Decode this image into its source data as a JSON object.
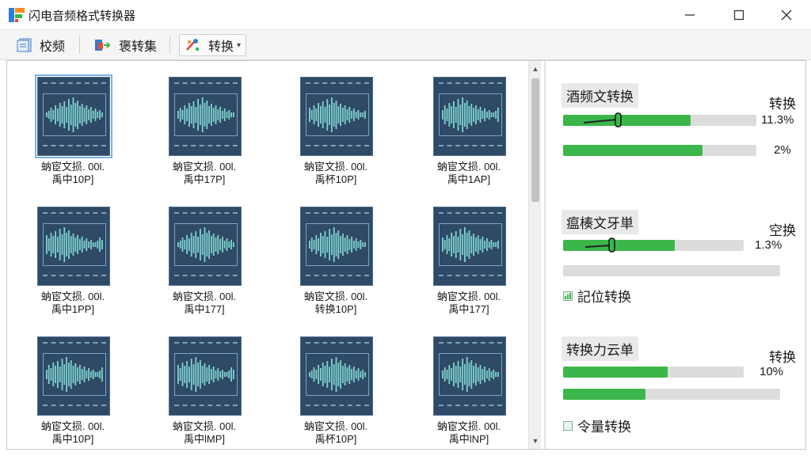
{
  "window": {
    "title": "闪电音频格式转换器",
    "controls": {
      "minimize": "—",
      "maximize": "☐",
      "close": "✕"
    }
  },
  "toolbar": {
    "b1_label": "校频",
    "b2_label": "褒转集",
    "b3_label": "转换"
  },
  "files": [
    {
      "line1": "蚋宦文损. 00l.",
      "line2": "禹中10P]"
    },
    {
      "line1": "蚋宦文损. 00l.",
      "line2": "禹中17P]"
    },
    {
      "line1": "蚋宦文损. 00l.",
      "line2": "禹杯10P]"
    },
    {
      "line1": "蚋宦文损. 00l.",
      "line2": "禹中1AP]"
    },
    {
      "line1": "蚋宦文损. 00l.",
      "line2": "禹中1PP]"
    },
    {
      "line1": "蚋宦文损. 00l.",
      "line2": "禹中177]"
    },
    {
      "line1": "蚋宦文损. 00l.",
      "line2": "转换10P]"
    },
    {
      "line1": "蚋宦文损. 00l.",
      "line2": "禹中177]"
    },
    {
      "line1": "蚋宦文损. 00l.",
      "line2": "禹中10P]"
    },
    {
      "line1": "蚋宦文损. 00l.",
      "line2": "禹中lMP]"
    },
    {
      "line1": "蚋宦文损. 00l.",
      "line2": "禹杯10P]"
    },
    {
      "line1": "蚋宦文损. 00l.",
      "line2": "禹中lNP]"
    }
  ],
  "tasks": [
    {
      "title": "酒频文转换",
      "status": "转换",
      "progress1": {
        "value": 0.66,
        "pct": "11.3%"
      },
      "progress2": {
        "value": 0.72,
        "pct": "2%"
      }
    },
    {
      "title": "瘟楱文牙単",
      "status": "空换",
      "progress1": {
        "value": 0.62,
        "pct": "1.3%"
      },
      "option": "記位转换"
    },
    {
      "title": "转换力云单",
      "status": "转换",
      "progress1": {
        "value": 0.58,
        "pct": "10%"
      },
      "progress2": {
        "value": 0.38
      },
      "option": "令量转换"
    }
  ],
  "colors": {
    "progress_fill": "#3cb64a",
    "progress_track": "#dcdcdc",
    "thumb_bg": "#2f4a66",
    "wave": "#7fd3cf",
    "selection": "#7fb0e6"
  }
}
